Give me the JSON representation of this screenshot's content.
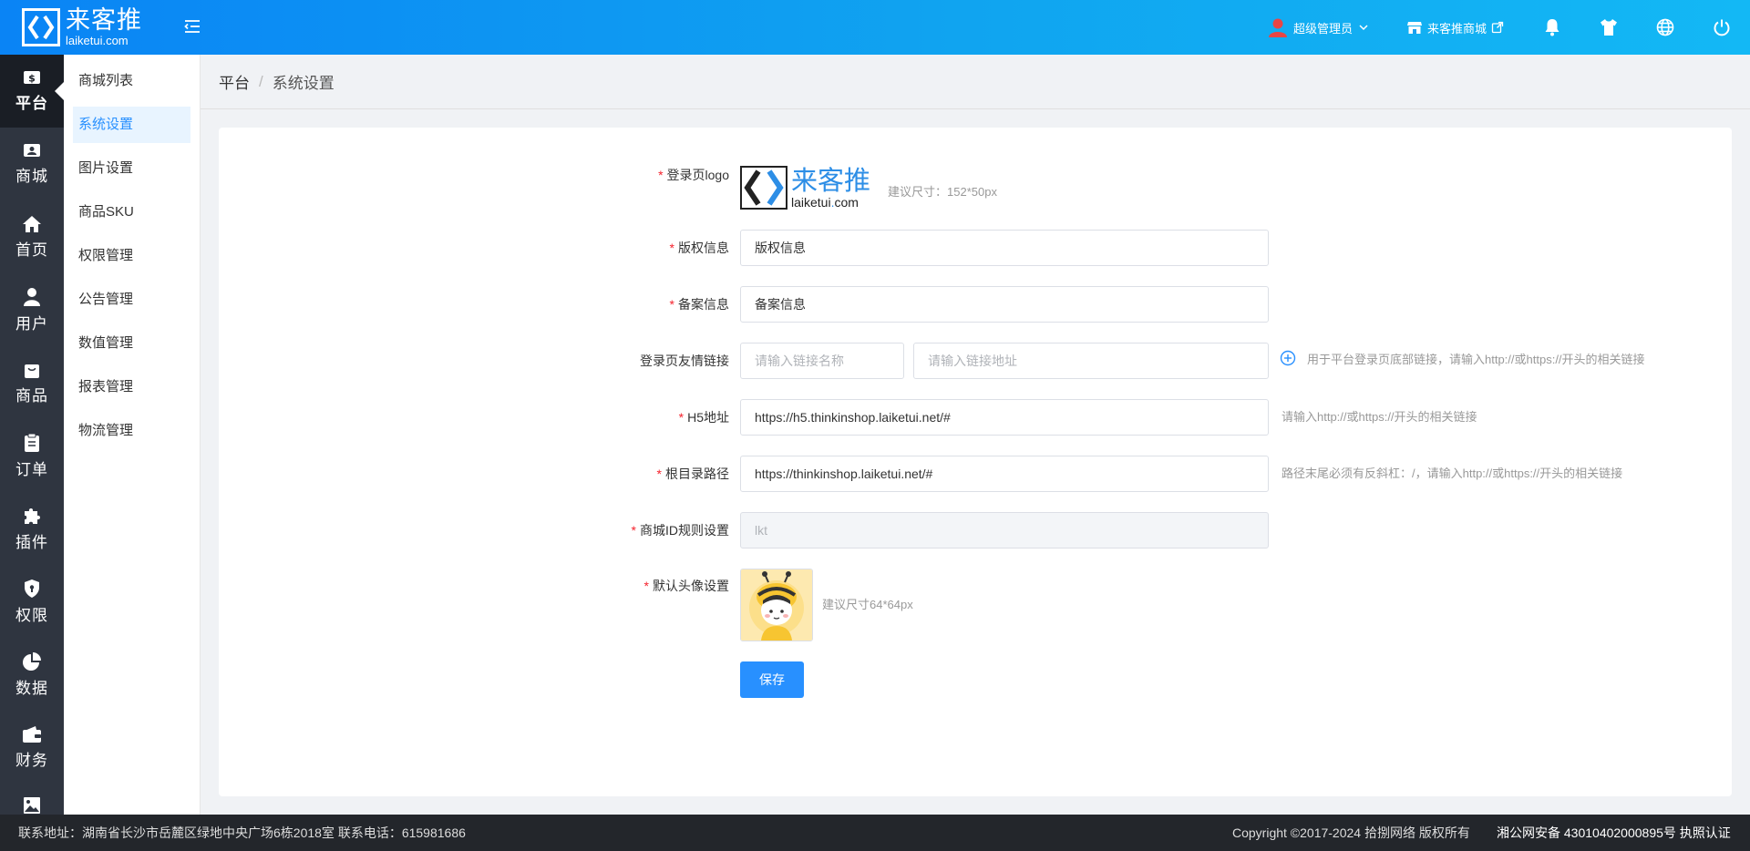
{
  "header": {
    "logo_cn": "来客推",
    "logo_en": "laiketui.com",
    "user_name": "超级管理员",
    "store_name": "来客推商城"
  },
  "sidebar": {
    "items": [
      {
        "label": "平台",
        "icon": "dollar-card-icon"
      },
      {
        "label": "商城",
        "icon": "store-card-icon"
      },
      {
        "label": "首页",
        "icon": "home-icon"
      },
      {
        "label": "用户",
        "icon": "user-icon"
      },
      {
        "label": "商品",
        "icon": "bag-icon"
      },
      {
        "label": "订单",
        "icon": "clipboard-icon"
      },
      {
        "label": "插件",
        "icon": "puzzle-icon"
      },
      {
        "label": "权限",
        "icon": "shield-icon"
      },
      {
        "label": "数据",
        "icon": "pie-chart-icon"
      },
      {
        "label": "财务",
        "icon": "wallet-icon"
      }
    ]
  },
  "submenu": {
    "items": [
      {
        "label": "商城列表"
      },
      {
        "label": "系统设置"
      },
      {
        "label": "图片设置"
      },
      {
        "label": "商品SKU"
      },
      {
        "label": "权限管理"
      },
      {
        "label": "公告管理"
      },
      {
        "label": "数值管理"
      },
      {
        "label": "报表管理"
      },
      {
        "label": "物流管理"
      }
    ]
  },
  "breadcrumb": {
    "root": "平台",
    "separator": "/",
    "current": "系统设置"
  },
  "form": {
    "logo": {
      "label": "登录页logo",
      "logo_cn": "来客推",
      "logo_en_pre": "laiketui",
      "logo_en_dot": ".",
      "logo_en_post": "com",
      "hint": "建议尺寸：152*50px"
    },
    "copyright": {
      "label": "版权信息",
      "value": "版权信息"
    },
    "icp": {
      "label": "备案信息",
      "value": "备案信息"
    },
    "friend_link": {
      "label": "登录页友情链接",
      "name_placeholder": "请输入链接名称",
      "url_placeholder": "请输入链接地址",
      "hint": "用于平台登录页底部链接，请输入http://或https://开头的相关链接"
    },
    "h5": {
      "label": "H5地址",
      "value": "https://h5.thinkinshop.laiketui.net/#",
      "hint": "请输入http://或https://开头的相关链接"
    },
    "root_path": {
      "label": "根目录路径",
      "value": "https://thinkinshop.laiketui.net/#",
      "hint": "路径末尾必须有反斜杠：/，请输入http://或https://开头的相关链接"
    },
    "store_id": {
      "label": "商城ID规则设置",
      "value": "lkt"
    },
    "avatar": {
      "label": "默认头像设置",
      "hint": "建议尺寸64*64px"
    },
    "required_mark": "*",
    "save_label": "保存"
  },
  "footer": {
    "address": "联系地址：湖南省长沙市岳麓区绿地中央广场6栋2018室 联系电话：615981686",
    "copyright": "Copyright ©2017-2024 拾捌网络 版权所有",
    "beian": "湘公网安备 43010402000895号 执照认证"
  },
  "colors": {
    "primary": "#2890ff",
    "sidebar_bg": "#2f3540",
    "required": "#f5222d"
  }
}
